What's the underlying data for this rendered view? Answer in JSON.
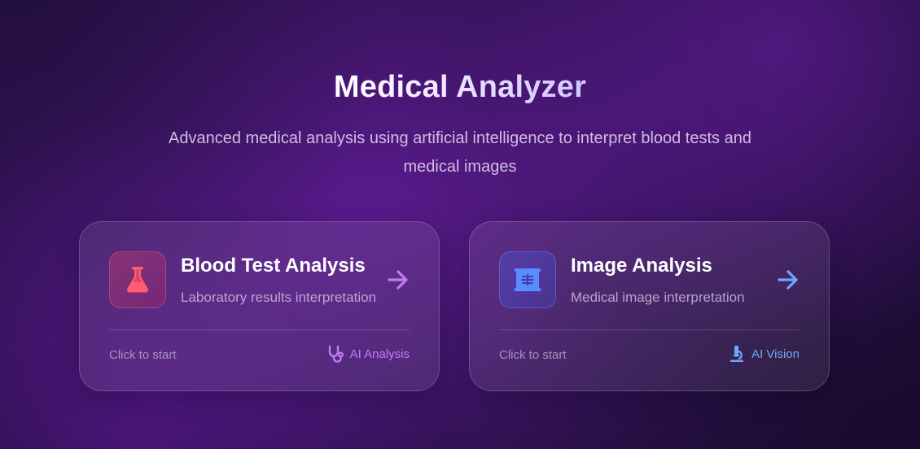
{
  "header": {
    "title": "Medical Analyzer",
    "subtitle": "Advanced medical analysis using artificial intelligence to interpret blood tests and medical images"
  },
  "cards": [
    {
      "title": "Blood Test Analysis",
      "description": "Laboratory results interpretation",
      "footer_left": "Click to start",
      "footer_right": "AI Analysis",
      "icon": "flask-icon",
      "badge_icon": "stethoscope-icon",
      "accent": "#c17cf2",
      "icon_color": "#ff5c6e"
    },
    {
      "title": "Image Analysis",
      "description": "Medical image interpretation",
      "footer_left": "Click to start",
      "footer_right": "AI Vision",
      "icon": "x-ray-icon",
      "badge_icon": "microscope-icon",
      "accent": "#6ea8ff",
      "icon_color": "#5b8cff"
    }
  ]
}
